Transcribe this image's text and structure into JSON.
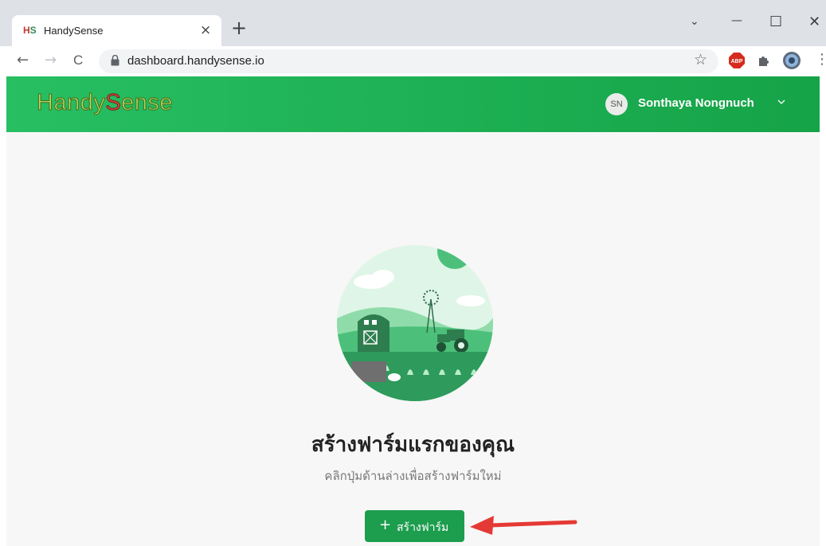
{
  "browser": {
    "tab_favicon_h": "H",
    "tab_favicon_s": "S",
    "tab_title": "HandySense",
    "tab_close": "×",
    "new_tab": "+",
    "window_controls": {
      "dropdown": "⌄",
      "minimize": "—",
      "maximize": "☐",
      "close": "✕"
    },
    "nav": {
      "back": "←",
      "forward": "→",
      "reload": "C"
    },
    "url": "dashboard.handysense.io",
    "star": "☆",
    "extensions": [
      "abp-icon",
      "puzzle-icon",
      "profile-icon"
    ],
    "abp_label": "ABP",
    "menu": "⋮"
  },
  "header": {
    "logo_part1": "Handy",
    "logo_s": "S",
    "logo_part2": "ense",
    "avatar_initials": "SN",
    "user_name": "Sonthaya Nongnuch",
    "colors": {
      "start": "#27bf62",
      "end": "#16a348"
    }
  },
  "main": {
    "title": "สร้างฟาร์มแรกของคุณ",
    "subtitle": "คลิกปุ่มด้านล่างเพื่อสร้างฟาร์มใหม่",
    "create_button_icon": "+",
    "create_button_label": "สร้างฟาร์ม"
  },
  "annotation": {
    "arrow_color": "#e53935"
  }
}
